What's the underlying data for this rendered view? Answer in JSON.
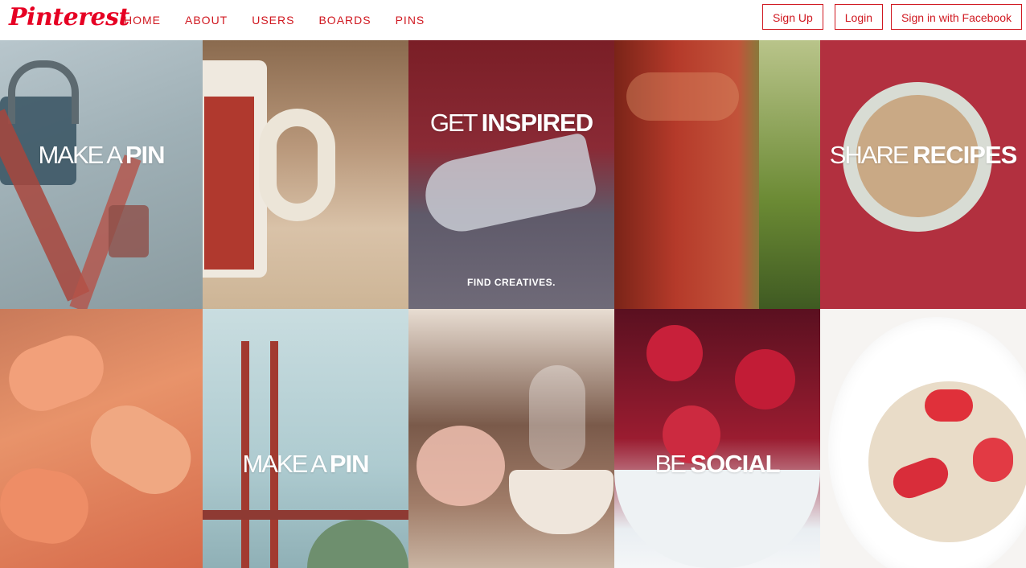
{
  "brand": {
    "name": "Pinterest",
    "color": "#e60023"
  },
  "nav": {
    "items": [
      {
        "label": "HOME"
      },
      {
        "label": "ABOUT"
      },
      {
        "label": "USERS"
      },
      {
        "label": "BOARDS"
      },
      {
        "label": "PINS"
      }
    ]
  },
  "auth": {
    "signup_label": "Sign Up",
    "login_label": "Login",
    "facebook_label": "Sign in with Facebook"
  },
  "tiles": {
    "locks": {
      "caption_light": "MAKE A ",
      "caption_strong": "PIN"
    },
    "shoes": {
      "caption_light": "GET ",
      "caption_strong": "INSPIRED",
      "sub": "FIND CREATIVES."
    },
    "coffee": {
      "caption_light": "SHARE ",
      "caption_strong": "RECIPES"
    },
    "bridge": {
      "caption_light": "MAKE A ",
      "caption_strong": "PIN"
    },
    "raspberries": {
      "caption_light": "BE ",
      "caption_strong": "SOCIAL"
    }
  }
}
